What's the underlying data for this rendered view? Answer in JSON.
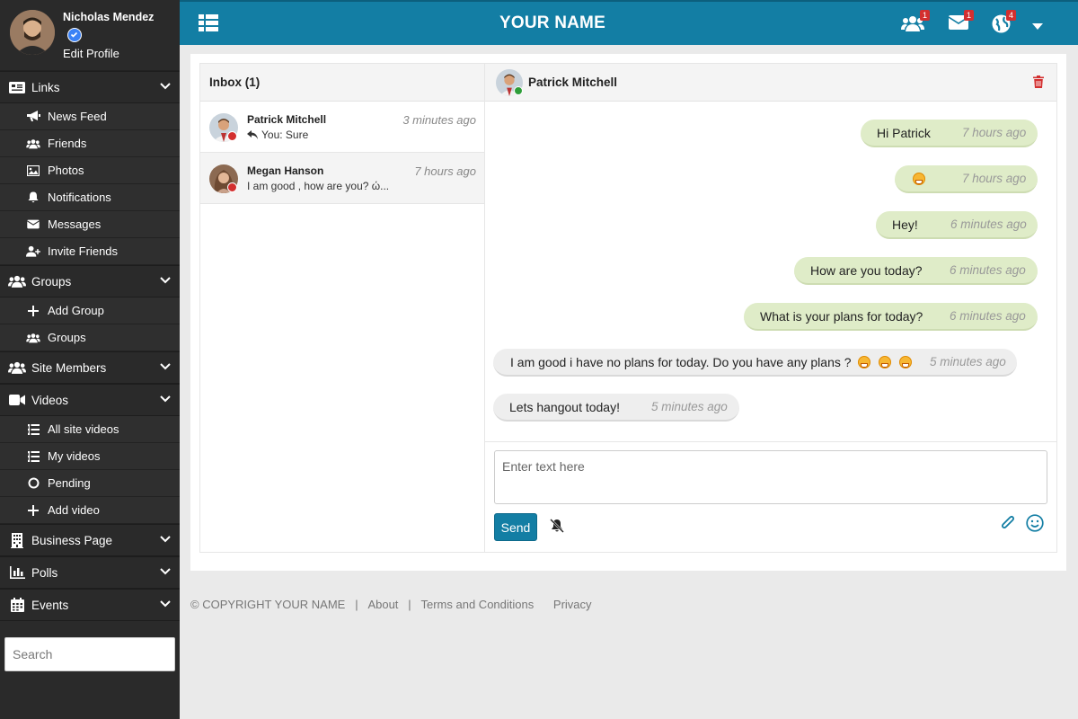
{
  "sidebar": {
    "profile": {
      "name": "Nicholas Mendez",
      "edit_label": "Edit Profile"
    },
    "sections": [
      {
        "label": "Links",
        "icon": "newspaper-icon",
        "items": [
          {
            "label": "News Feed",
            "icon": "megaphone-icon"
          },
          {
            "label": "Friends",
            "icon": "users-icon"
          },
          {
            "label": "Photos",
            "icon": "image-icon"
          },
          {
            "label": "Notifications",
            "icon": "bell-icon"
          },
          {
            "label": "Messages",
            "icon": "envelope-icon"
          },
          {
            "label": "Invite Friends",
            "icon": "user-plus-icon"
          }
        ]
      },
      {
        "label": "Groups",
        "icon": "users-icon",
        "items": [
          {
            "label": "Add Group",
            "icon": "plus-icon"
          },
          {
            "label": "Groups",
            "icon": "users-icon"
          }
        ]
      },
      {
        "label": "Site Members",
        "icon": "users-icon",
        "items": []
      },
      {
        "label": "Videos",
        "icon": "video-icon",
        "items": [
          {
            "label": "All site videos",
            "icon": "list-icon"
          },
          {
            "label": "My videos",
            "icon": "list-icon"
          },
          {
            "label": "Pending",
            "icon": "circle-icon"
          },
          {
            "label": "Add video",
            "icon": "plus-icon"
          }
        ]
      },
      {
        "label": "Business Page",
        "icon": "building-icon",
        "items": []
      },
      {
        "label": "Polls",
        "icon": "chart-icon",
        "items": []
      },
      {
        "label": "Events",
        "icon": "calendar-icon",
        "items": []
      }
    ],
    "search_placeholder": "Search"
  },
  "topbar": {
    "brand": "YOUR NAME",
    "badges": {
      "friends": "1",
      "messages": "1",
      "notifications": "4"
    }
  },
  "inbox": {
    "title": "Inbox (1)",
    "conversations": [
      {
        "name": "Patrick Mitchell",
        "preview": "You: Sure",
        "time": "3 minutes ago"
      },
      {
        "name": "Megan Hanson",
        "preview": "I am good , how are you? ώ...",
        "time": "7 hours ago"
      }
    ]
  },
  "chat": {
    "contact": "Patrick Mitchell",
    "messages": [
      {
        "text": "Hi Patrick",
        "time": "7 hours ago",
        "dir": "out"
      },
      {
        "text": "",
        "emojis": 1,
        "time": "7 hours ago",
        "dir": "out"
      },
      {
        "text": "Hey!",
        "time": "6 minutes ago",
        "dir": "out"
      },
      {
        "text": "How are you today?",
        "time": "6 minutes ago",
        "dir": "out"
      },
      {
        "text": "What is your plans for today?",
        "time": "6 minutes ago",
        "dir": "out"
      },
      {
        "text": "I am good i have no plans for today. Do you have any plans ?",
        "emojis": 3,
        "time": "5 minutes ago",
        "dir": "in"
      },
      {
        "text": "Lets hangout today!",
        "time": "5 minutes ago",
        "dir": "in"
      }
    ],
    "composer": {
      "placeholder": "Enter text here",
      "send_label": "Send"
    }
  },
  "footer": {
    "copyright": "© COPYRIGHT YOUR NAME",
    "sep": "|",
    "links": [
      "About",
      "Terms and Conditions",
      "Privacy"
    ]
  },
  "colors": {
    "accent": "#137ea4",
    "sidebar": "#2a2a2a",
    "outgoing_bubble": "#dfecc8",
    "incoming_bubble": "#eeeeee",
    "danger": "#d32f2f"
  }
}
